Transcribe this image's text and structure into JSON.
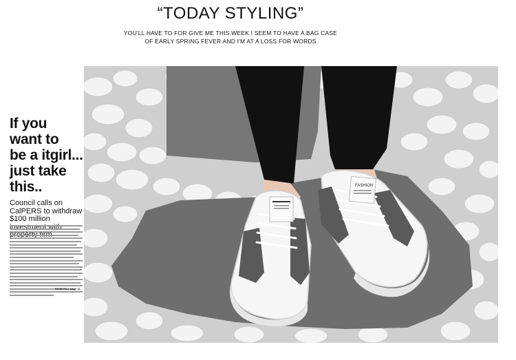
{
  "header": {
    "title": "“TODAY STYLING”",
    "subtitle_line1": "YOU'LL HAVE TO FOR GIVE ME THIS WEEK I SEEM TO HAVE A BAG CASE",
    "subtitle_line2": "OF EARLY SPRING FEVER AND I'M AT A LOSS FOR WORDS"
  },
  "article": {
    "headline_line1": "If you",
    "headline_line2": "want to",
    "headline_line3": "be a itgirl...",
    "headline_line4": "just take",
    "headline_line5": "this..",
    "subhead": "Council calls on CalPERS to withdraw $100 million investment with property firm",
    "footer": "PAGE PA.L page 11"
  },
  "photo": {
    "tag_text": "FASHION",
    "colors": {
      "stone": "#6e6e6e",
      "pebble": "#f2f2f2",
      "pants": "#111111",
      "suede": "#5a5a5a"
    }
  }
}
